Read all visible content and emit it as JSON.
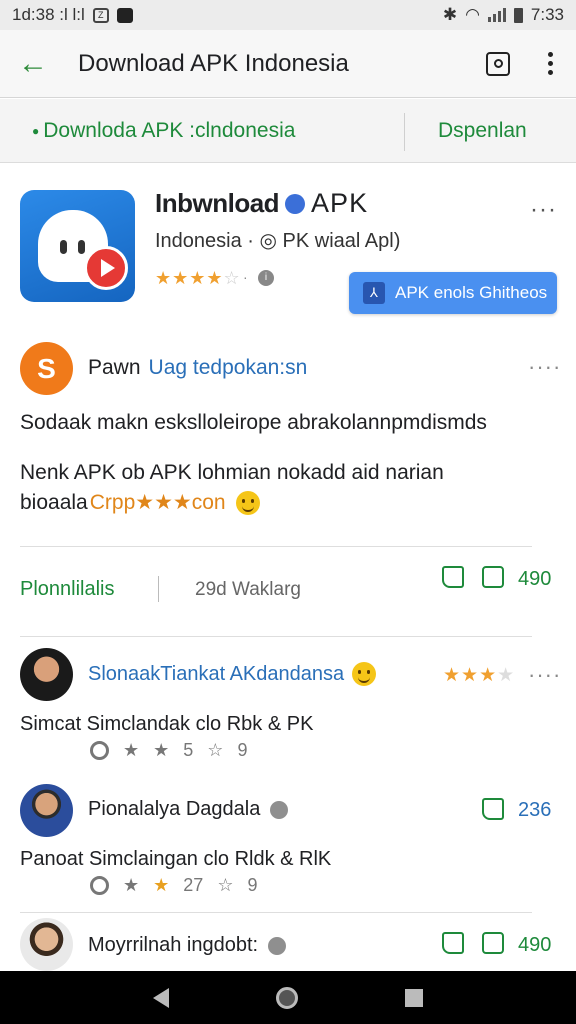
{
  "status_bar": {
    "left_text": "1d:38 :l l:l",
    "right_time": "7:33",
    "box_glyph": "Z"
  },
  "app_bar": {
    "back_icon": "arrow-left-icon",
    "title": "Download APK Indonesia",
    "actions": [
      "frame-icon",
      "more-vertical-icon"
    ]
  },
  "sub_bar": {
    "left_link": "Downloda APK :clndonesia",
    "right_link": "Dspenlan",
    "accent": "#1e8a3b"
  },
  "app_card": {
    "name_bold": "Inbwnload",
    "name_rest": "APK",
    "subtitle": "Indonesia · ◎ PK wiaal Apl)",
    "rating": 4,
    "rating_max": 5,
    "dots": "·",
    "more": "···",
    "button_label": "APK enols Ghitheos",
    "button_color": "#4a90f0",
    "icon_colors": [
      "#2c8ae8",
      "#e53935"
    ]
  },
  "post": {
    "avatar_letter": "S",
    "author": "Pawn",
    "tag": "Uag tedpokan:sn",
    "more": "····",
    "line1": "Sodaak makn eskslloleirope abrakolannpmdismds",
    "line2": "Nenk APK ob APK lohmian nokadd aid narian",
    "line3_plain": "bioaala",
    "line3_highlight": "Crpp★★★con"
  },
  "stats": {
    "left": "Plonnlilalis",
    "mid": "29d Waklarg",
    "count": "490"
  },
  "comments": [
    {
      "name": "SlonaakTiankat AKdandansa",
      "rating": 3,
      "rating_max": 4,
      "more": "····",
      "text": "Simcat Simclandak clo Rbk & PK",
      "meta_a": "5",
      "meta_b": "9"
    },
    {
      "name": "Pionalalya Dagdala",
      "count": "236",
      "text": "Panoat Simclaingan clo Rldk & RlK",
      "meta_a": "27",
      "meta_b": "9"
    },
    {
      "name": "Moyrrilnah ingdobt:",
      "count": "490"
    }
  ],
  "nav_bar": {
    "buttons": [
      "nav-back-icon",
      "nav-home-icon",
      "nav-recent-icon"
    ]
  }
}
